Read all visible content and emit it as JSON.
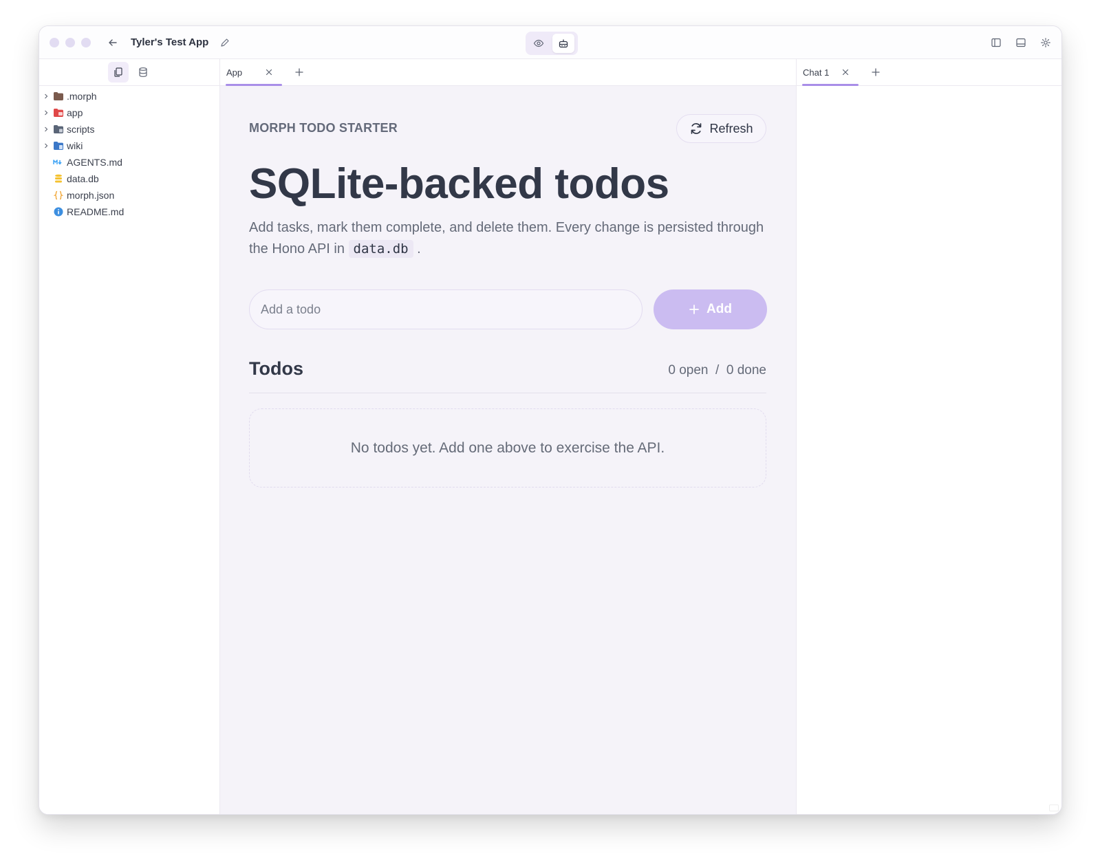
{
  "window": {
    "title": "Tyler's Test App"
  },
  "sidebar": {
    "tabs": [
      {
        "icon": "files-icon",
        "active": true
      },
      {
        "icon": "database-icon",
        "active": false
      }
    ],
    "items": [
      {
        "label": ".morph",
        "type": "folder",
        "icon": "folder-icon",
        "color": "#7a5a4d",
        "expandable": true
      },
      {
        "label": "app",
        "type": "folder",
        "icon": "folder-app-icon",
        "color": "#e04848",
        "expandable": true
      },
      {
        "label": "scripts",
        "type": "folder",
        "icon": "folder-scripts-icon",
        "color": "#5a6577",
        "expandable": true
      },
      {
        "label": "wiki",
        "type": "folder",
        "icon": "folder-wiki-icon",
        "color": "#3b78c8",
        "expandable": true
      },
      {
        "label": "AGENTS.md",
        "type": "file",
        "icon": "markdown-icon",
        "color": "#42a5f5",
        "expandable": false
      },
      {
        "label": "data.db",
        "type": "file",
        "icon": "database-file-icon",
        "color": "#f5c230",
        "expandable": false
      },
      {
        "label": "morph.json",
        "type": "file",
        "icon": "json-icon",
        "color": "#f2a93b",
        "expandable": false
      },
      {
        "label": "README.md",
        "type": "file",
        "icon": "info-icon",
        "color": "#3d8fe0",
        "expandable": false
      }
    ]
  },
  "editor": {
    "tab_label": "App",
    "eyebrow": "MORPH TODO STARTER",
    "refresh_label": "Refresh",
    "headline": "SQLite-backed todos",
    "description_before": "Add tasks, mark them complete, and delete them. Every change is persisted through the Hono API in ",
    "description_code": "data.db",
    "description_after": " .",
    "input_placeholder": "Add a todo",
    "input_value": "",
    "add_label": "Add",
    "todos_heading": "Todos",
    "todos_count": "0 open  /  0 done",
    "empty_message": "No todos yet. Add one above to exercise the API."
  },
  "chat": {
    "tab_label": "Chat 1"
  },
  "colors": {
    "accent": "#a98ee8",
    "add_button": "#cbbcf1",
    "panel_bg": "#f5f3f9"
  }
}
